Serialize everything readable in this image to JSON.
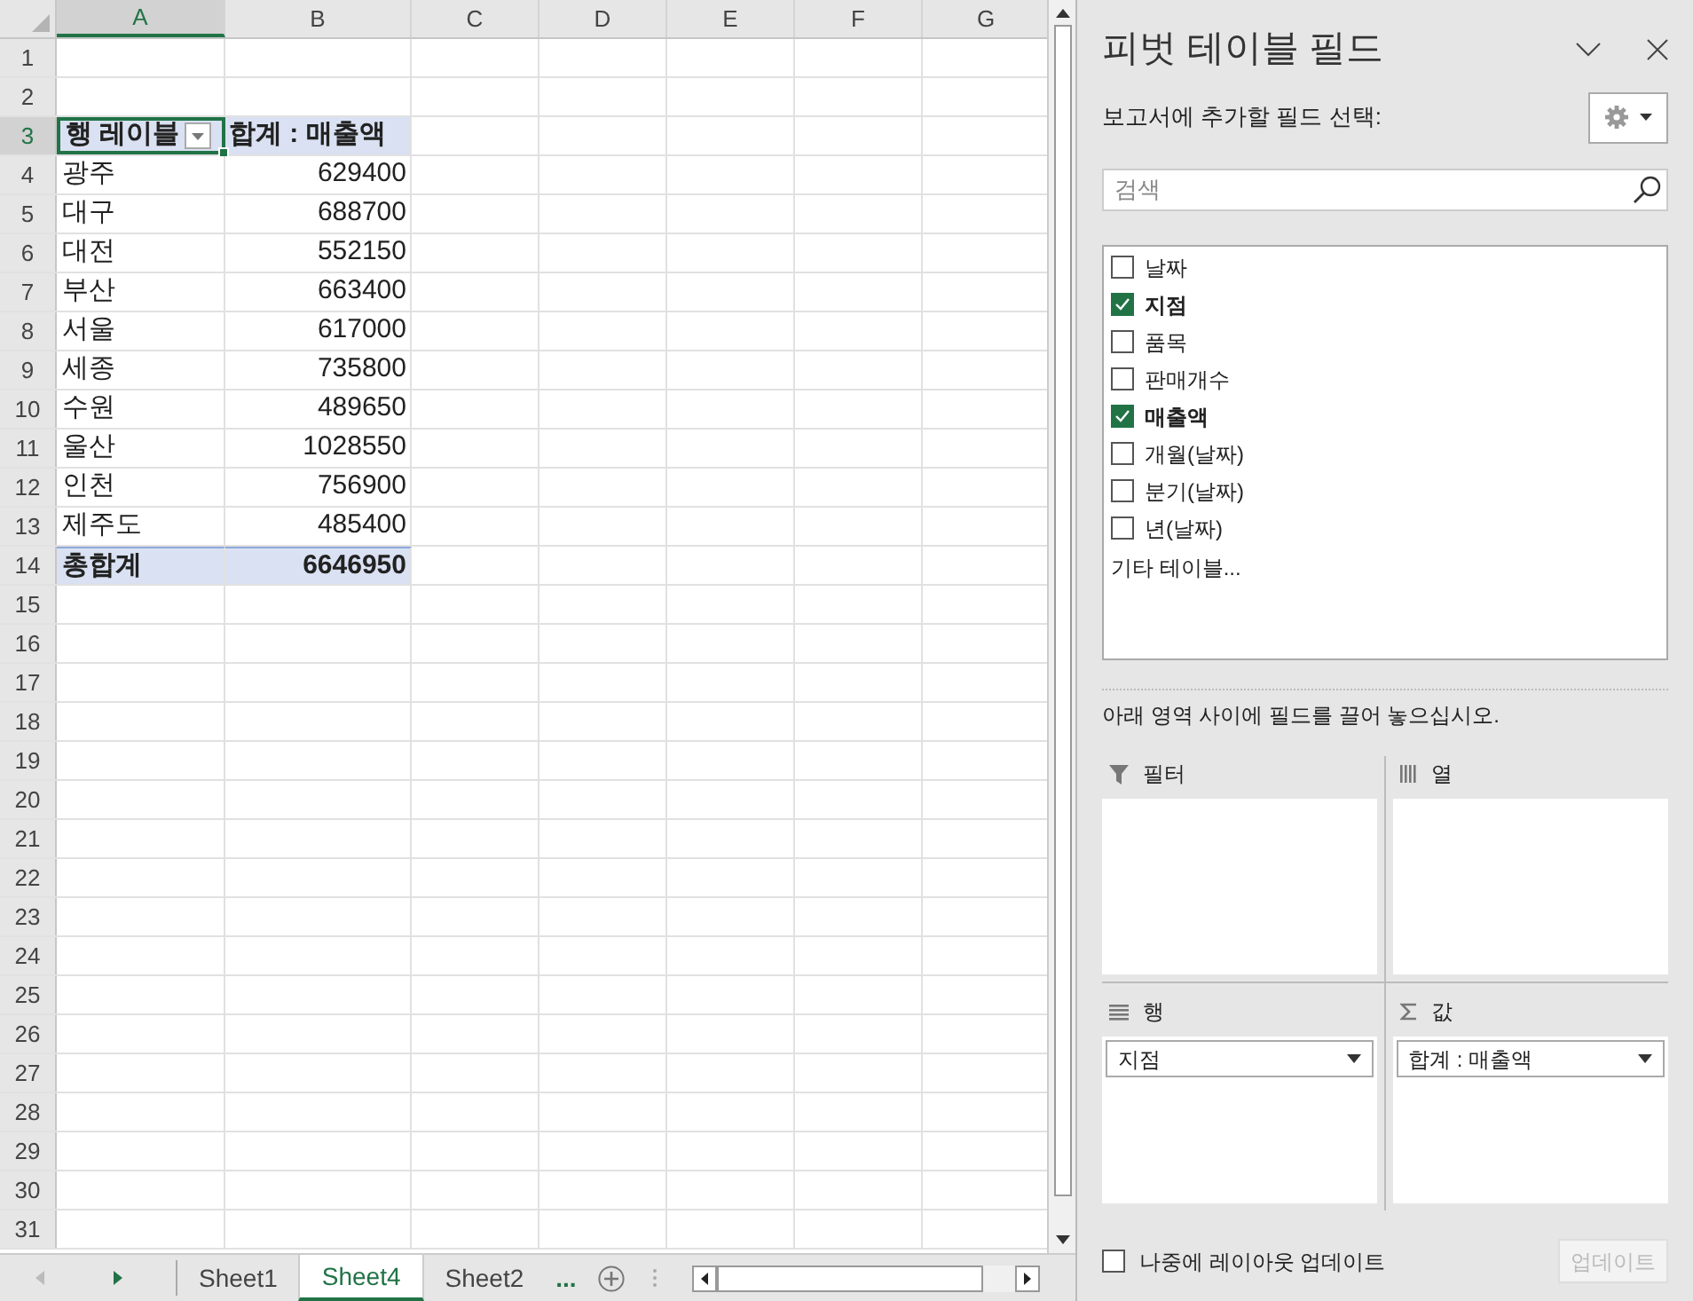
{
  "sheet": {
    "columns": [
      {
        "label": "A",
        "selected": true
      },
      {
        "label": "B",
        "selected": false
      },
      {
        "label": "C",
        "selected": false
      },
      {
        "label": "D",
        "selected": false
      },
      {
        "label": "E",
        "selected": false
      },
      {
        "label": "F",
        "selected": false
      },
      {
        "label": "G",
        "selected": false
      }
    ],
    "row_numbers": [
      {
        "label": "1",
        "selected": false
      },
      {
        "label": "2",
        "selected": false
      },
      {
        "label": "3",
        "selected": true
      },
      {
        "label": "4",
        "selected": false
      },
      {
        "label": "5",
        "selected": false
      },
      {
        "label": "6",
        "selected": false
      },
      {
        "label": "7",
        "selected": false
      },
      {
        "label": "8",
        "selected": false
      },
      {
        "label": "9",
        "selected": false
      },
      {
        "label": "10",
        "selected": false
      },
      {
        "label": "11",
        "selected": false
      },
      {
        "label": "12",
        "selected": false
      },
      {
        "label": "13",
        "selected": false
      },
      {
        "label": "14",
        "selected": false
      },
      {
        "label": "15",
        "selected": false
      },
      {
        "label": "16",
        "selected": false
      },
      {
        "label": "17",
        "selected": false
      },
      {
        "label": "18",
        "selected": false
      },
      {
        "label": "19",
        "selected": false
      },
      {
        "label": "20",
        "selected": false
      },
      {
        "label": "21",
        "selected": false
      },
      {
        "label": "22",
        "selected": false
      },
      {
        "label": "23",
        "selected": false
      },
      {
        "label": "24",
        "selected": false
      },
      {
        "label": "25",
        "selected": false
      },
      {
        "label": "26",
        "selected": false
      },
      {
        "label": "27",
        "selected": false
      },
      {
        "label": "28",
        "selected": false
      },
      {
        "label": "29",
        "selected": false
      },
      {
        "label": "30",
        "selected": false
      },
      {
        "label": "31",
        "selected": false
      }
    ],
    "pivot": {
      "header": {
        "label": "행 레이블",
        "value": "합계 : 매출액"
      },
      "rows": [
        {
          "label": "광주",
          "value": "629400"
        },
        {
          "label": "대구",
          "value": "688700"
        },
        {
          "label": "대전",
          "value": "552150"
        },
        {
          "label": "부산",
          "value": "663400"
        },
        {
          "label": "서울",
          "value": "617000"
        },
        {
          "label": "세종",
          "value": "735800"
        },
        {
          "label": "수원",
          "value": "489650"
        },
        {
          "label": "울산",
          "value": "1028550"
        },
        {
          "label": "인천",
          "value": "756900"
        },
        {
          "label": "제주도",
          "value": "485400"
        }
      ],
      "total": {
        "label": "총합계",
        "value": "6646950"
      }
    }
  },
  "sheet_tabs": [
    {
      "label": "Sheet1",
      "selected": false
    },
    {
      "label": "Sheet4",
      "selected": true
    },
    {
      "label": "Sheet2",
      "selected": false
    }
  ],
  "more_tabs": "...",
  "field_pane": {
    "title": "피벗 테이블 필드",
    "subtitle": "보고서에 추가할 필드 선택:",
    "search": {
      "placeholder": "검색"
    },
    "fields": [
      {
        "label": "날짜",
        "checked": false
      },
      {
        "label": "지점",
        "checked": true
      },
      {
        "label": "품목",
        "checked": false
      },
      {
        "label": "판매개수",
        "checked": false
      },
      {
        "label": "매출액",
        "checked": true
      },
      {
        "label": "개월(날짜)",
        "checked": false
      },
      {
        "label": "분기(날짜)",
        "checked": false
      },
      {
        "label": "년(날짜)",
        "checked": false
      }
    ],
    "more_tables": "기타 테이블...",
    "hint": "아래 영역 사이에 필드를 끌어 놓으십시오.",
    "areas": [
      {
        "kind": "filter",
        "label": "필터"
      },
      {
        "kind": "columns",
        "label": "열"
      },
      {
        "kind": "rows",
        "label": "행",
        "items": [
          "지점"
        ]
      },
      {
        "kind": "values",
        "label": "값",
        "items": [
          "합계 : 매출액"
        ]
      }
    ],
    "defer_update": {
      "label": "나중에 레이아웃 업데이트",
      "checked": false
    },
    "update_button": {
      "label": "업데이트",
      "disabled": true
    }
  }
}
